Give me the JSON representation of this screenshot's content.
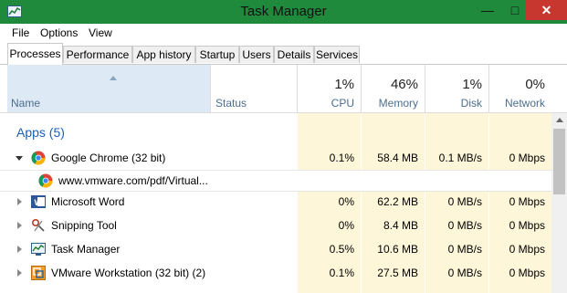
{
  "window": {
    "title": "Task Manager",
    "minimize_glyph": "—",
    "maximize_glyph": "□",
    "close_glyph": "✕"
  },
  "menu": {
    "items": [
      "File",
      "Options",
      "View"
    ]
  },
  "tabs": [
    "Processes",
    "Performance",
    "App history",
    "Startup",
    "Users",
    "Details",
    "Services"
  ],
  "active_tab": "Processes",
  "header": {
    "name": "Name",
    "status": "Status",
    "cpu": {
      "pct": "1%",
      "label": "CPU"
    },
    "memory": {
      "pct": "46%",
      "label": "Memory"
    },
    "disk": {
      "pct": "1%",
      "label": "Disk"
    },
    "network": {
      "pct": "0%",
      "label": "Network"
    }
  },
  "group": {
    "title": "Apps (5)"
  },
  "rows": [
    {
      "name": "Google Chrome (32 bit)",
      "cpu": "0.1%",
      "memory": "58.4 MB",
      "disk": "0.1 MB/s",
      "network": "0 Mbps",
      "icon": "chrome-icon",
      "expanded": true
    },
    {
      "name": "www.vmware.com/pdf/Virtual...",
      "child": true,
      "icon": "chrome-icon"
    },
    {
      "name": "Microsoft Word",
      "cpu": "0%",
      "memory": "62.2 MB",
      "disk": "0 MB/s",
      "network": "0 Mbps",
      "icon": "word-icon"
    },
    {
      "name": "Snipping Tool",
      "cpu": "0%",
      "memory": "8.4 MB",
      "disk": "0 MB/s",
      "network": "0 Mbps",
      "icon": "scissors-icon"
    },
    {
      "name": "Task Manager",
      "cpu": "0.5%",
      "memory": "10.6 MB",
      "disk": "0 MB/s",
      "network": "0 Mbps",
      "icon": "task-manager-icon"
    },
    {
      "name": "VMware Workstation (32 bit) (2)",
      "cpu": "0.1%",
      "memory": "27.5 MB",
      "disk": "0 MB/s",
      "network": "0 Mbps",
      "icon": "vmware-icon"
    }
  ],
  "colors": {
    "title_bar": "#1f8a3c",
    "close_button": "#c7372f",
    "group_title": "#1e5fb4",
    "column_highlight": "#fdf6d8",
    "sort_header": "#dde9f5"
  }
}
